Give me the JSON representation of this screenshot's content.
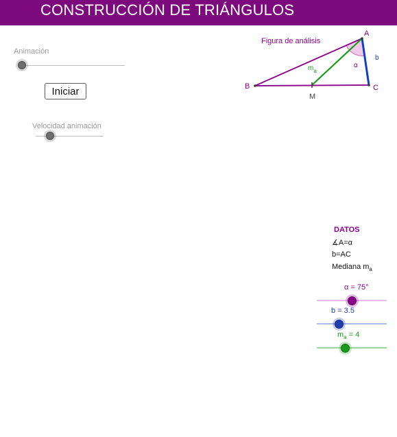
{
  "header": {
    "title": "CONSTRUCCIÓN DE TRIÁNGULOS",
    "color": "#7d0a7d"
  },
  "controls": {
    "animation_label": "Animación",
    "start_button": "Iniciar",
    "speed_label": "Velocidad animación"
  },
  "figure": {
    "title": "Figura de análisis",
    "vertex_a": "A",
    "vertex_b": "B",
    "vertex_c": "C",
    "point_m": "M",
    "side_b": "b",
    "angle": "α",
    "median_main": "m",
    "median_sub": "a",
    "colors": {
      "triangle": "#8b008b",
      "side_b": "#1040c8",
      "median": "#1a9a1a",
      "angle_fill": "#f3c9e8"
    }
  },
  "datos": {
    "title": "DATOS",
    "line1": "∡A=α",
    "line2": "b=AC",
    "line3_main": "Mediana m",
    "line3_sub": "a"
  },
  "params": {
    "alpha": {
      "label": "α = 75°",
      "value": 75,
      "color": "#8b008b"
    },
    "b": {
      "label": "b = 3.5",
      "value": 3.5,
      "color": "#1f3fb0"
    },
    "ma": {
      "label_main": "m",
      "label_sub": "a",
      "label_rest": " = 4",
      "value": 4,
      "color": "#1a9a1a"
    }
  }
}
